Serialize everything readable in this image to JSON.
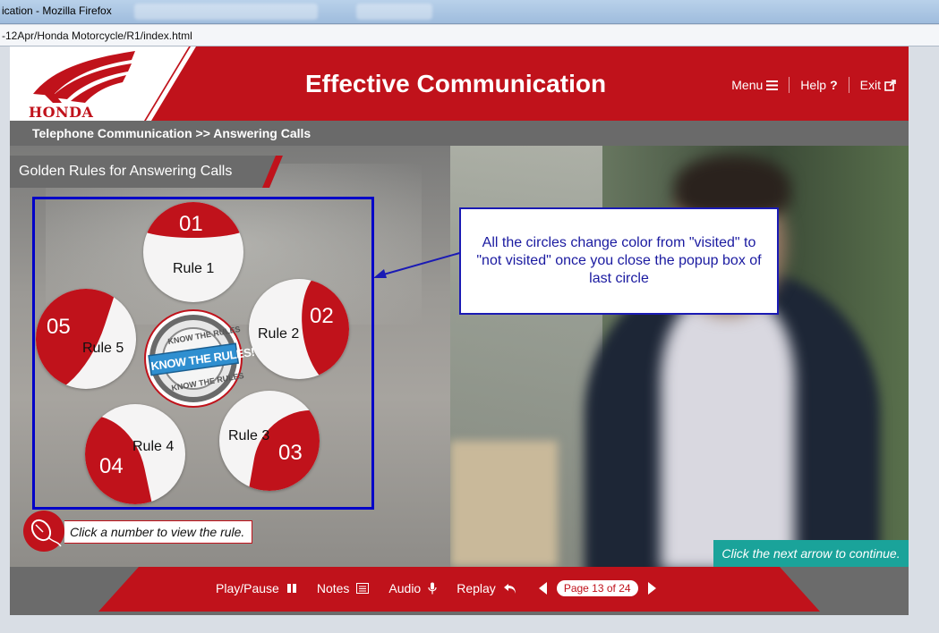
{
  "browser": {
    "window_title": "ication - Mozilla Firefox",
    "url": "-12Apr/Honda Motorcycle/R1/index.html"
  },
  "header": {
    "brand": "HONDA",
    "title": "Effective Communication",
    "nav": {
      "menu": "Menu",
      "help": "Help",
      "exit": "Exit"
    }
  },
  "breadcrumb": "Telephone Communication >> Answering Calls",
  "section": {
    "title": "Golden Rules for Answering Calls"
  },
  "rules": [
    {
      "number": "01",
      "label": "Rule 1"
    },
    {
      "number": "02",
      "label": "Rule 2"
    },
    {
      "number": "03",
      "label": "Rule 3"
    },
    {
      "number": "04",
      "label": "Rule 4"
    },
    {
      "number": "05",
      "label": "Rule 5"
    }
  ],
  "badge": {
    "top_text": "KNOW THE RULES",
    "main_text": "KNOW THE RULES!",
    "bottom_text": "KNOW THE RULES"
  },
  "callout": "All the circles change color from \"visited\" to \"not visited\" once you close the popup box of last circle",
  "hint": "Click a number to view the rule.",
  "next_hint": "Click the next arrow to continue.",
  "footer": {
    "play_pause": "Play/Pause",
    "notes": "Notes",
    "audio": "Audio",
    "replay": "Replay",
    "page": "Page 13 of 24"
  },
  "colors": {
    "brand_red": "#c0121b",
    "annotation_blue": "#0000c8",
    "teal": "#1aa39a"
  }
}
